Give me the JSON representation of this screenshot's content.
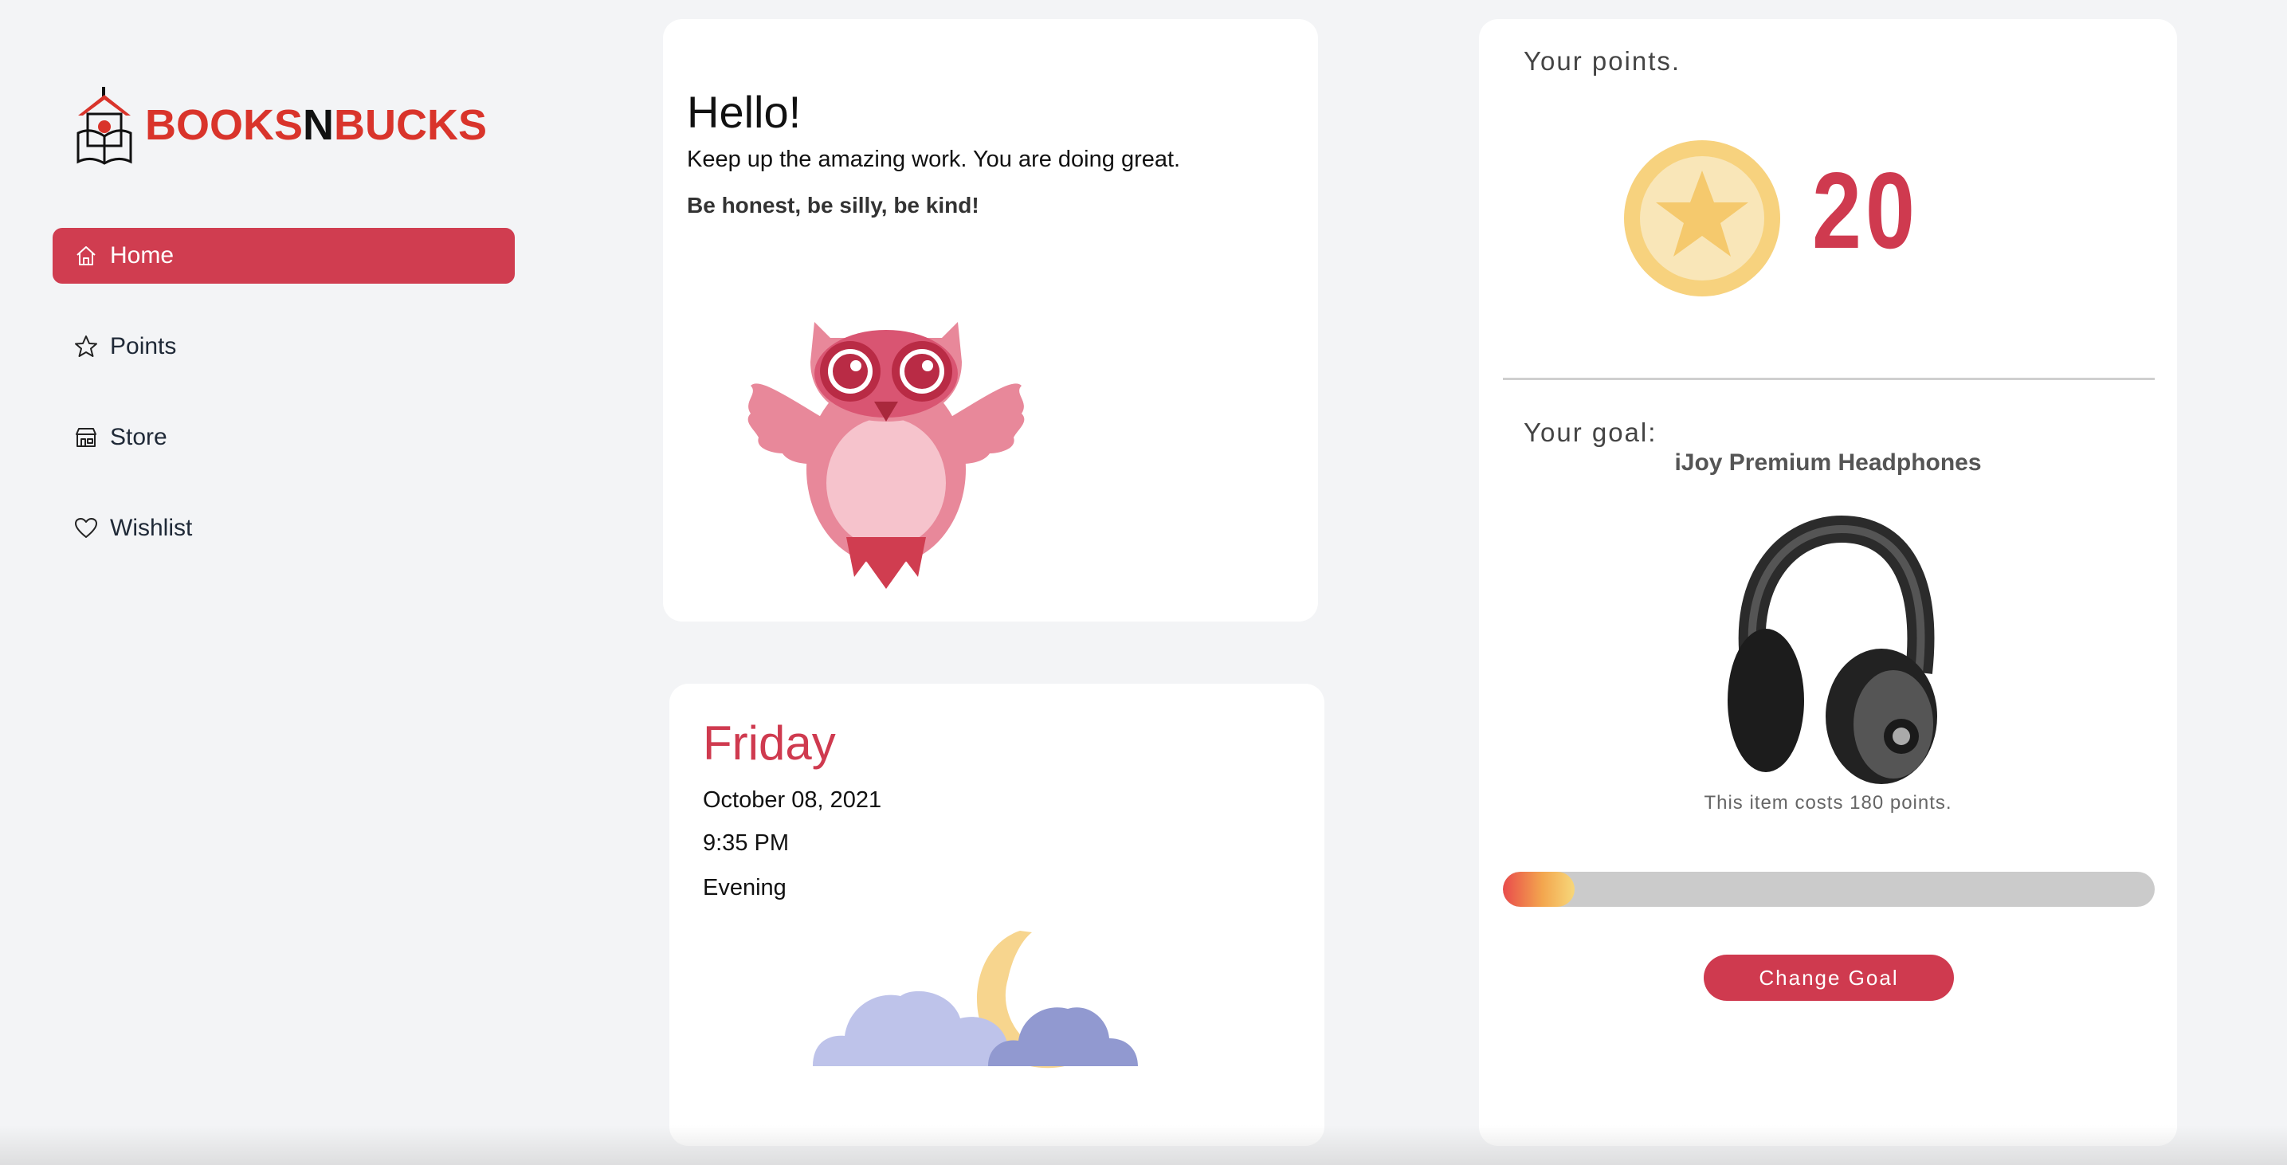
{
  "logo": {
    "part1": "BOOKS",
    "part2": "N",
    "part3": "BUCKS"
  },
  "sidebar": {
    "items": [
      {
        "label": "Home",
        "icon": "home-icon",
        "active": true
      },
      {
        "label": "Points",
        "icon": "star-icon",
        "active": false
      },
      {
        "label": "Store",
        "icon": "store-icon",
        "active": false
      },
      {
        "label": "Wishlist",
        "icon": "heart-icon",
        "active": false
      }
    ]
  },
  "hello": {
    "title": "Hello!",
    "subtitle": "Keep up the amazing work. You are doing great.",
    "motto": "Be honest, be silly, be kind!"
  },
  "date": {
    "day": "Friday",
    "date": "October 08, 2021",
    "time": "9:35 PM",
    "period": "Evening"
  },
  "points": {
    "label": "Your points.",
    "value": "20"
  },
  "goal": {
    "label": "Your goal:",
    "name": "iJoy Premium Headphones",
    "cost_text": "This item costs 180 points.",
    "progress_fraction": 0.11,
    "button_label": "Change Goal"
  },
  "colors": {
    "accent": "#cf3a4f",
    "coin": "#f7d27e",
    "background": "#f3f4f6"
  }
}
